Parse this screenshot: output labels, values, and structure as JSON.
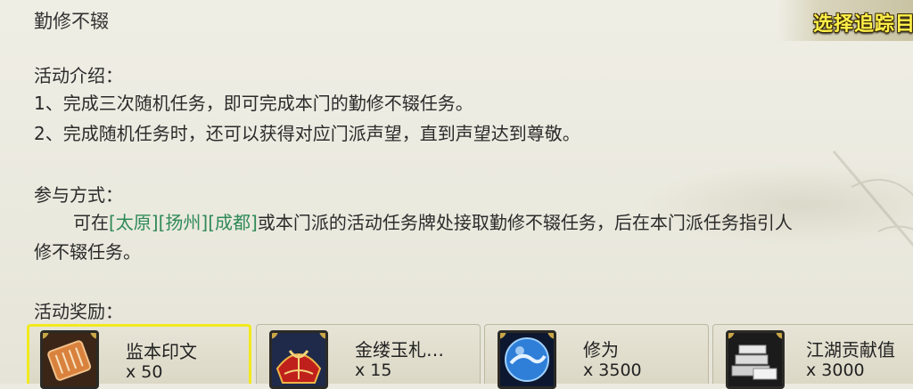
{
  "title": "勤修不辍",
  "track_button": "选择追踪目",
  "intro": {
    "heading": "活动介绍：",
    "line1": "1、完成三次随机任务，即可完成本门的勤修不辍任务。",
    "line2": "2、完成随机任务时，还可以获得对应门派声望，直到声望达到尊敬。"
  },
  "participation": {
    "heading": "参与方式：",
    "prefix": "可在",
    "links": [
      "[太原]",
      "[扬州]",
      "[成都]"
    ],
    "suffix": "或本门派的活动任务牌处接取勤修不辍任务，后在本门派任务指引人",
    "line2": "修不辍任务。"
  },
  "rewards": {
    "heading": "活动奖励：",
    "items": [
      {
        "name": "监本印文",
        "qty": "x 50",
        "icon": "seal-scroll-icon",
        "selected": true
      },
      {
        "name": "金缕玉札…",
        "qty": "x 15",
        "icon": "red-gift-pouch-icon",
        "selected": false
      },
      {
        "name": "修为",
        "qty": "x 3500",
        "icon": "blue-orb-icon",
        "selected": false
      },
      {
        "name": "江湖贡献值",
        "qty": "x 3000",
        "icon": "silver-ingot-icon",
        "selected": false
      }
    ]
  }
}
